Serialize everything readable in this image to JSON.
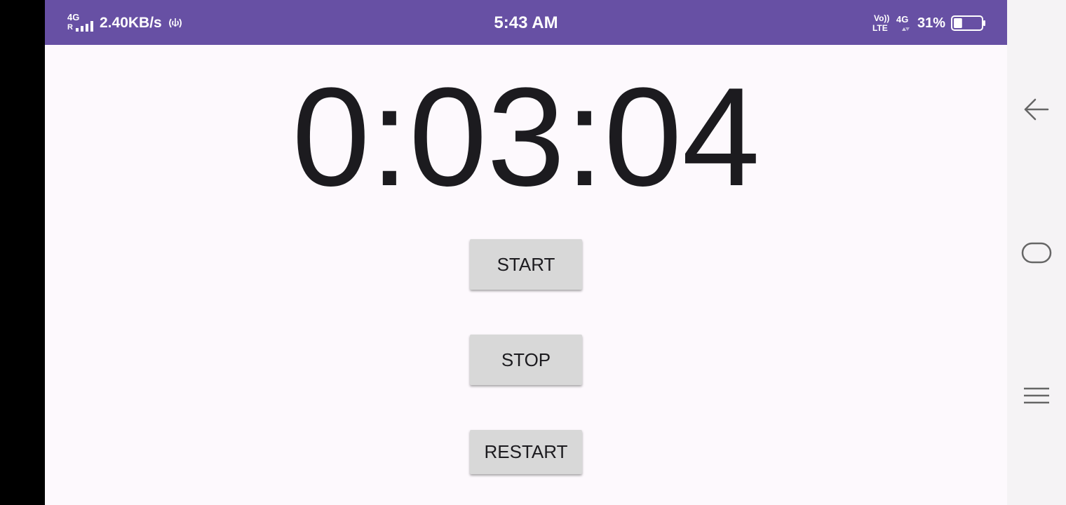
{
  "status_bar": {
    "network_type": "4G",
    "roaming": "R",
    "data_speed": "2.40KB/s",
    "time": "5:43 AM",
    "volte_top": "Vo))",
    "volte_bottom": "LTE",
    "network_type_2": "4G",
    "battery_percent": "31%",
    "battery_level": 0.31,
    "background_color": "#6750a4",
    "icons": [
      "signal-icon",
      "hotspot-icon",
      "volte-icon",
      "data-arrows-icon",
      "battery-icon"
    ]
  },
  "stopwatch": {
    "time_display": "0:03:04"
  },
  "buttons": {
    "start_label": "START",
    "stop_label": "STOP",
    "restart_label": "RESTART"
  },
  "nav_bar": {
    "icons": [
      "back-icon",
      "home-icon",
      "menu-icon"
    ]
  }
}
